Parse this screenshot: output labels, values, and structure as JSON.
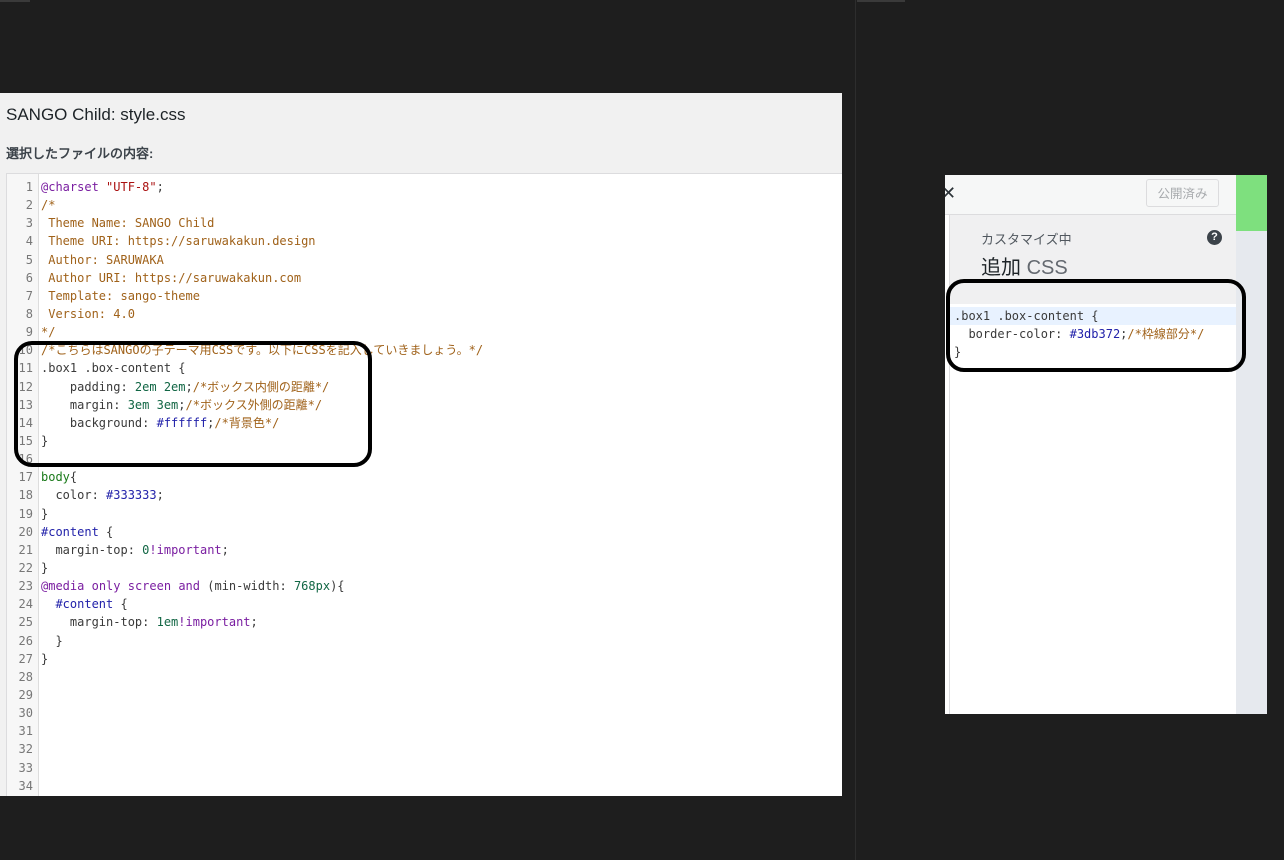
{
  "editor": {
    "title": "SANGO Child: style.css",
    "subtitle": "選択したファイルの内容:",
    "lines": [
      {
        "num": "1",
        "segments": [
          {
            "cls": "t-kw",
            "text": "@charset"
          },
          {
            "cls": "t-def",
            "text": " "
          },
          {
            "cls": "t-str",
            "text": "\"UTF-8\""
          },
          {
            "cls": "t-def",
            "text": ";"
          }
        ]
      },
      {
        "num": "2",
        "segments": [
          {
            "cls": "t-cmt",
            "text": "/*"
          }
        ]
      },
      {
        "num": "3",
        "segments": [
          {
            "cls": "t-cmt",
            "text": " Theme Name: SANGO Child"
          }
        ]
      },
      {
        "num": "4",
        "segments": [
          {
            "cls": "t-cmt",
            "text": " Theme URI: https://saruwakakun.design"
          }
        ]
      },
      {
        "num": "5",
        "segments": [
          {
            "cls": "t-cmt",
            "text": " Author: SARUWAKA"
          }
        ]
      },
      {
        "num": "6",
        "segments": [
          {
            "cls": "t-cmt",
            "text": " Author URI: https://saruwakakun.com"
          }
        ]
      },
      {
        "num": "7",
        "segments": [
          {
            "cls": "t-cmt",
            "text": " Template: sango-theme"
          }
        ]
      },
      {
        "num": "8",
        "segments": [
          {
            "cls": "t-cmt",
            "text": " Version: 4.0"
          }
        ]
      },
      {
        "num": "9",
        "segments": [
          {
            "cls": "t-cmt",
            "text": "*/"
          }
        ]
      },
      {
        "num": "10",
        "segments": [
          {
            "cls": "t-cmt",
            "text": "/*こちらはSANGOの子テーマ用CSSです。以下にCSSを記入していきましょう。*/"
          }
        ]
      },
      {
        "num": "11",
        "segments": [
          {
            "cls": "t-def",
            "text": ".box1 .box-content {"
          }
        ]
      },
      {
        "num": "12",
        "segments": [
          {
            "cls": "t-def",
            "text": "    padding: "
          },
          {
            "cls": "t-num",
            "text": "2em 2em"
          },
          {
            "cls": "t-def",
            "text": ";"
          },
          {
            "cls": "t-cmt",
            "text": "/*ボックス内側の距離*/"
          }
        ]
      },
      {
        "num": "13",
        "segments": [
          {
            "cls": "t-def",
            "text": "    margin: "
          },
          {
            "cls": "t-num",
            "text": "3em 3em"
          },
          {
            "cls": "t-def",
            "text": ";"
          },
          {
            "cls": "t-cmt",
            "text": "/*ボックス外側の距離*/"
          }
        ]
      },
      {
        "num": "14",
        "segments": [
          {
            "cls": "t-def",
            "text": "    background: "
          },
          {
            "cls": "t-val",
            "text": "#ffffff"
          },
          {
            "cls": "t-def",
            "text": ";"
          },
          {
            "cls": "t-cmt",
            "text": "/*背景色*/"
          }
        ]
      },
      {
        "num": "15",
        "segments": [
          {
            "cls": "t-def",
            "text": "}"
          }
        ]
      },
      {
        "num": "16",
        "segments": []
      },
      {
        "num": "17",
        "segments": [
          {
            "cls": "t-tag",
            "text": "body"
          },
          {
            "cls": "t-def",
            "text": "{"
          }
        ]
      },
      {
        "num": "18",
        "segments": [
          {
            "cls": "t-def",
            "text": "  color: "
          },
          {
            "cls": "t-val",
            "text": "#333333"
          },
          {
            "cls": "t-def",
            "text": ";"
          }
        ]
      },
      {
        "num": "19",
        "segments": [
          {
            "cls": "t-def",
            "text": "}"
          }
        ]
      },
      {
        "num": "20",
        "segments": [
          {
            "cls": "t-val",
            "text": "#content"
          },
          {
            "cls": "t-def",
            "text": " {"
          }
        ]
      },
      {
        "num": "21",
        "segments": [
          {
            "cls": "t-def",
            "text": "  margin-top: "
          },
          {
            "cls": "t-num",
            "text": "0"
          },
          {
            "cls": "t-kw",
            "text": "!important"
          },
          {
            "cls": "t-def",
            "text": ";"
          }
        ]
      },
      {
        "num": "22",
        "segments": [
          {
            "cls": "t-def",
            "text": "}"
          }
        ]
      },
      {
        "num": "23",
        "segments": [
          {
            "cls": "t-kw",
            "text": "@media"
          },
          {
            "cls": "t-def",
            "text": " "
          },
          {
            "cls": "t-kw",
            "text": "only"
          },
          {
            "cls": "t-def",
            "text": " "
          },
          {
            "cls": "t-kw",
            "text": "screen"
          },
          {
            "cls": "t-def",
            "text": " "
          },
          {
            "cls": "t-kw",
            "text": "and"
          },
          {
            "cls": "t-def",
            "text": " (min-width: "
          },
          {
            "cls": "t-num",
            "text": "768px"
          },
          {
            "cls": "t-def",
            "text": "){"
          }
        ]
      },
      {
        "num": "24",
        "segments": [
          {
            "cls": "t-def",
            "text": "  "
          },
          {
            "cls": "t-val",
            "text": "#content"
          },
          {
            "cls": "t-def",
            "text": " {"
          }
        ]
      },
      {
        "num": "25",
        "segments": [
          {
            "cls": "t-def",
            "text": "    margin-top: "
          },
          {
            "cls": "t-num",
            "text": "1em"
          },
          {
            "cls": "t-kw",
            "text": "!important"
          },
          {
            "cls": "t-def",
            "text": ";"
          }
        ]
      },
      {
        "num": "26",
        "segments": [
          {
            "cls": "t-def",
            "text": "  }"
          }
        ]
      },
      {
        "num": "27",
        "segments": [
          {
            "cls": "t-def",
            "text": "}"
          }
        ]
      },
      {
        "num": "28",
        "segments": []
      },
      {
        "num": "29",
        "segments": []
      },
      {
        "num": "30",
        "segments": []
      },
      {
        "num": "31",
        "segments": []
      },
      {
        "num": "32",
        "segments": []
      },
      {
        "num": "33",
        "segments": []
      },
      {
        "num": "34",
        "segments": []
      }
    ]
  },
  "customizer": {
    "close_glyph": "✕",
    "publish_label": "公開済み",
    "section_meta": "カスタマイズ中",
    "section_title_main": "追加",
    "section_title_css": "CSS",
    "help_glyph": "?",
    "back_glyph": "‹",
    "lines": [
      {
        "active": true,
        "segments": [
          {
            "cls": "t-def",
            "text": ".box1 .box-content {"
          }
        ]
      },
      {
        "active": false,
        "segments": [
          {
            "cls": "t-def",
            "text": "  border-color: "
          },
          {
            "cls": "t-val",
            "text": "#3db372"
          },
          {
            "cls": "t-def",
            "text": ";"
          },
          {
            "cls": "t-cmt",
            "text": "/*枠線部分*/"
          }
        ]
      },
      {
        "active": false,
        "segments": [
          {
            "cls": "t-def",
            "text": "}"
          }
        ]
      }
    ]
  },
  "colors": {
    "highlight_outline": "#000000",
    "accent_green": "#7ee07e",
    "background": "#1e1e1e"
  }
}
